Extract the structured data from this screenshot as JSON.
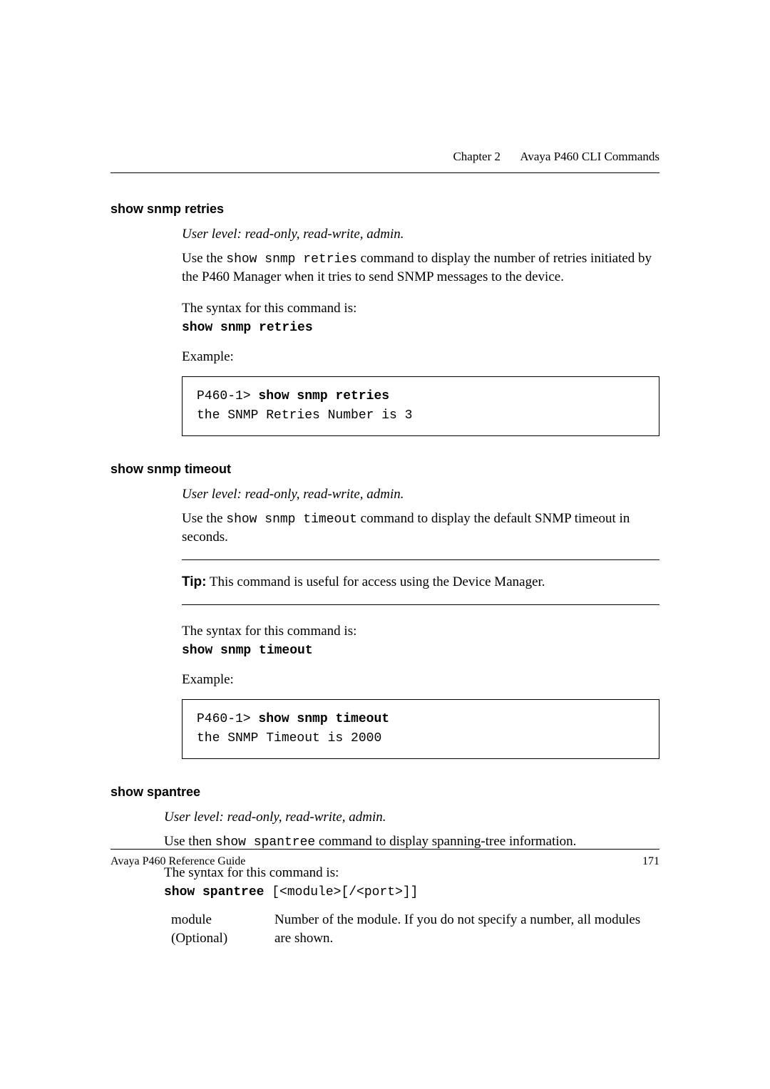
{
  "header": {
    "chapter": "Chapter 2",
    "title": "Avaya P460 CLI Commands"
  },
  "sections": [
    {
      "title": "show snmp retries",
      "user_level": "User level: read-only, read-write, admin.",
      "desc_prefix": "Use the ",
      "desc_cmd": "show snmp retries",
      "desc_suffix": " command to display the number of retries initiated by the P460 Manager when it tries to send SNMP messages to the device.",
      "syntax_intro": "The syntax for this command is:",
      "syntax": "show snmp retries",
      "example_label": "Example:",
      "example_prompt": "P460-1> ",
      "example_cmd": "show snmp retries",
      "example_output": "the SNMP Retries Number is 3"
    },
    {
      "title": "show snmp timeout",
      "user_level": "User level: read-only, read-write, admin.",
      "desc_prefix": "Use the ",
      "desc_cmd": "show snmp timeout",
      "desc_suffix": " command to display the default SNMP timeout in seconds.",
      "tip_label": "Tip:",
      "tip_text": "  This command is useful for access using the Device Manager.",
      "syntax_intro": "The syntax for this command is:",
      "syntax": "show snmp timeout",
      "example_label": "Example:",
      "example_prompt": "P460-1> ",
      "example_cmd": "show snmp timeout",
      "example_output": "the SNMP Timeout is 2000"
    },
    {
      "title": "show spantree",
      "user_level": "User level: read-only, read-write, admin.",
      "desc_prefix": "Use then ",
      "desc_cmd": "show spantree",
      "desc_suffix": " command to display spanning-tree information.",
      "syntax_intro": "The syntax for this command is:",
      "syntax_bold": "show spantree",
      "syntax_args": " [<module>[/<port>]]",
      "params": [
        {
          "name": "module",
          "optional": "(Optional)",
          "desc": "Number of the module. If you do not specify a number, all modules are shown."
        }
      ]
    }
  ],
  "footer": {
    "doc": "Avaya P460 Reference Guide",
    "page": "171"
  }
}
